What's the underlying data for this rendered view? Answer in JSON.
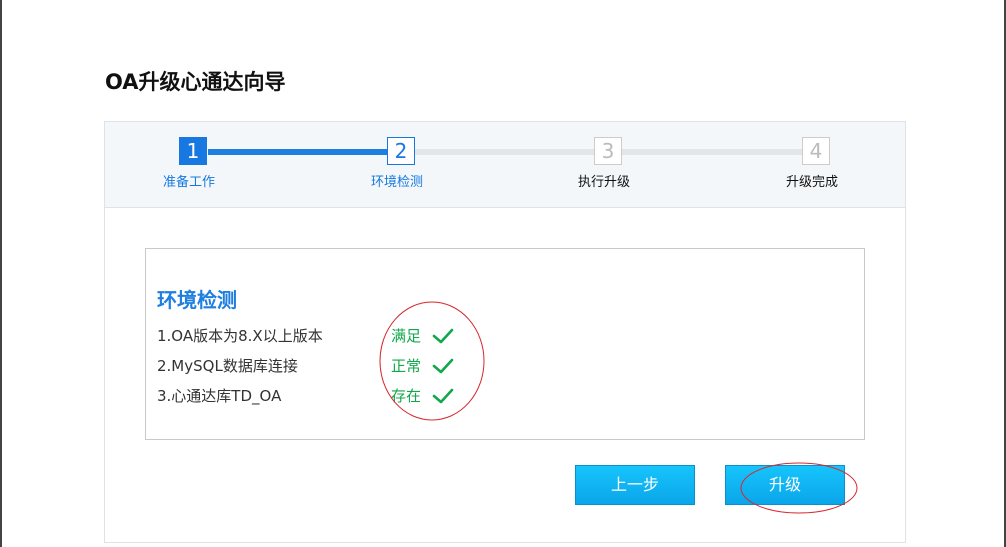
{
  "page": {
    "title": "OA升级心通达向导"
  },
  "steps": [
    {
      "number": "1",
      "label": "准备工作",
      "status": "completed"
    },
    {
      "number": "2",
      "label": "环境检测",
      "status": "current"
    },
    {
      "number": "3",
      "label": "执行升级",
      "status": "pending"
    },
    {
      "number": "4",
      "label": "升级完成",
      "status": "pending"
    }
  ],
  "check": {
    "title": "环境检测",
    "items": [
      {
        "label": "1.OA版本为8.X以上版本",
        "result": "满足",
        "icon": "check-icon"
      },
      {
        "label": "2.MySQL数据库连接",
        "result": "正常",
        "icon": "check-icon"
      },
      {
        "label": "3.心通达库TD_OA",
        "result": "存在",
        "icon": "check-icon"
      }
    ]
  },
  "buttons": {
    "prev_label": "上一步",
    "upgrade_label": "升级"
  },
  "colors": {
    "accent": "#1678e0",
    "success": "#11a84a",
    "button": "#0aa6ea",
    "annotation": "#d9262b"
  }
}
